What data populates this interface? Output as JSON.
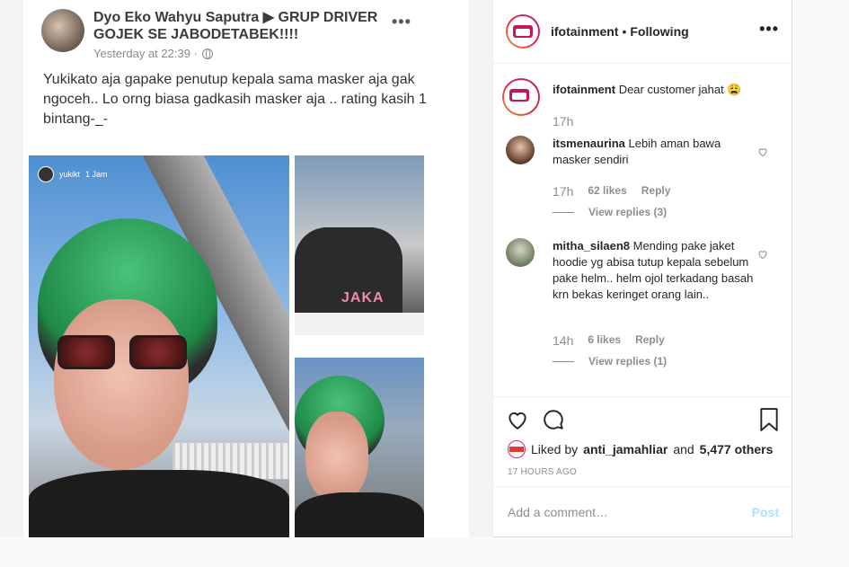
{
  "fb_post": {
    "author": "Dyo Eko Wahyu Saputra ▶ GRUP DRIVER GOJEK SE JABODETABEK!!!!",
    "time": "Yesterday at 22:39 ·",
    "text": "Yukikato aja gapake penutup kepala sama masker aja gak ngoceh.. Lo orng biasa gadkasih masker aja .. rating kasih 1 bintang-_-",
    "story_user": "yukikt",
    "story_time": "1 Jam",
    "sticker_text": "JAKA"
  },
  "header": {
    "username": "ifotainment",
    "separator": "•",
    "follow_label": "Following",
    "more": "•••"
  },
  "comments": [
    {
      "user": "ifotainment",
      "text": "Dear customer jahat 😩",
      "time": "17h"
    },
    {
      "user": "itsmenaurina",
      "text": "Lebih aman bawa masker sendiri",
      "time": "17h",
      "likes": "62 likes",
      "reply": "Reply",
      "view_replies": "View replies (3)"
    },
    {
      "user": "mitha_silaen8",
      "text": "Mending pake jaket hoodie yg abisa tutup kepala sebelum pake helm.. helm ojol terkadang basah krn bekas keringet orang lain..",
      "time": "14h",
      "likes": "6 likes",
      "reply": "Reply",
      "view_replies": "View replies (1)"
    }
  ],
  "likes": {
    "prefix": "Liked by",
    "user": "anti_jamahliar",
    "and": "and",
    "count": "5,477 others"
  },
  "timestamp": "17 HOURS AGO",
  "add_comment": {
    "placeholder": "Add a comment…",
    "post_label": "Post"
  },
  "colors": {
    "link_disabled": "#b2dffc",
    "muted": "#8e8e8e"
  }
}
